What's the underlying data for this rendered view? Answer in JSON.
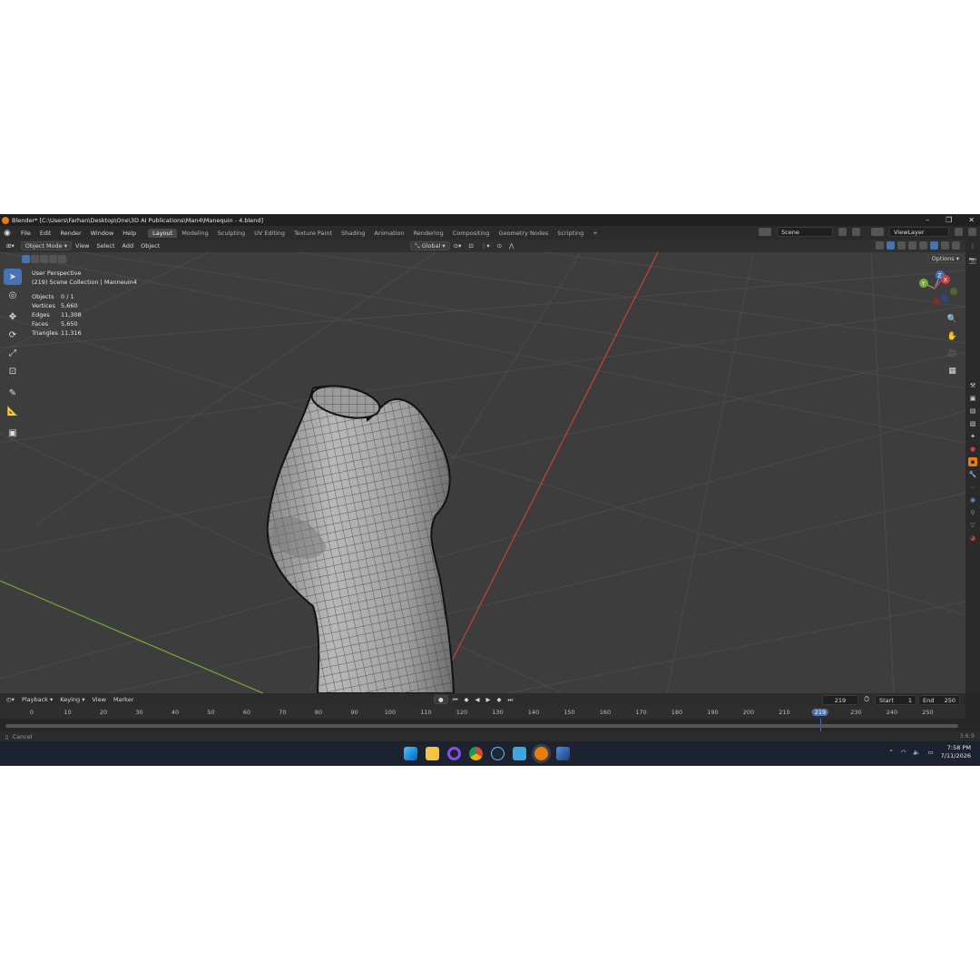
{
  "window": {
    "title": "Blender* [C:\\Users\\Farhan\\Desktop\\One\\3D AI Publications\\Man4\\Manequin - 4.blend]"
  },
  "menu": [
    "File",
    "Edit",
    "Render",
    "Window",
    "Help"
  ],
  "workspaces": [
    "Layout",
    "Modeling",
    "Sculpting",
    "UV Editing",
    "Texture Paint",
    "Shading",
    "Animation",
    "Rendering",
    "Compositing",
    "Geometry Nodes",
    "Scripting",
    "+"
  ],
  "active_workspace": "Layout",
  "scene": {
    "label": "Scene",
    "view_layer": "ViewLayer"
  },
  "viewport_header": {
    "mode": "Object Mode",
    "menus": [
      "View",
      "Select",
      "Add",
      "Object"
    ],
    "transform_orientation": "Global",
    "options_label": "Options"
  },
  "overlay": {
    "view_name": "User Perspective",
    "collection": "(219) Scene Collection | Manneuin4",
    "stats": [
      {
        "label": "Objects",
        "value": "0 / 1"
      },
      {
        "label": "Vertices",
        "value": "5,660"
      },
      {
        "label": "Edges",
        "value": "11,308"
      },
      {
        "label": "Faces",
        "value": "5,650"
      },
      {
        "label": "Triangles",
        "value": "11,316"
      }
    ]
  },
  "gizmo": {
    "axes": [
      "Z",
      "Y",
      "X"
    ]
  },
  "timeline": {
    "menus": [
      "Playback",
      "Keying",
      "View",
      "Marker"
    ],
    "current_frame": "219",
    "start_label": "Start",
    "start": "1",
    "end_label": "End",
    "end": "250",
    "ticks": [
      "0",
      "10",
      "20",
      "30",
      "40",
      "50",
      "60",
      "70",
      "80",
      "90",
      "100",
      "110",
      "120",
      "130",
      "140",
      "150",
      "160",
      "170",
      "180",
      "190",
      "200",
      "210",
      "219",
      "230",
      "240",
      "250"
    ]
  },
  "status": {
    "left": "Cancel",
    "version": "3.6.9"
  },
  "taskbar": {
    "time": "7:58 PM",
    "date": "7/11/2026",
    "apps": [
      "windows-start",
      "file-explorer",
      "cortana",
      "chrome",
      "steam",
      "notepad",
      "blender",
      "krita"
    ]
  },
  "colors": {
    "accent": "#4772b3",
    "x_axis": "#c94040",
    "y_axis": "#7aa83a"
  }
}
